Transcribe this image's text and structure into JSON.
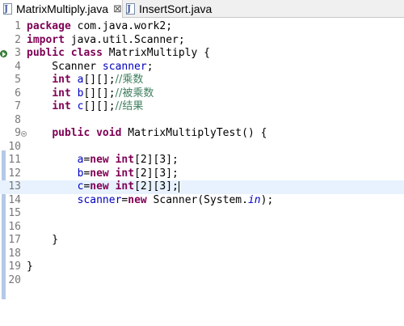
{
  "tabs": [
    {
      "label": "MatrixMultiply.java",
      "close": "⊠"
    },
    {
      "label": "InsertSort.java"
    }
  ],
  "editor": {
    "current_line": 13,
    "lines": [
      {
        "n": "1",
        "tokens": [
          {
            "t": "package",
            "c": "kw"
          },
          {
            "t": " com.java.work2;",
            "c": ""
          }
        ]
      },
      {
        "n": "2",
        "tokens": [
          {
            "t": "import",
            "c": "kw"
          },
          {
            "t": " java.util.Scanner;",
            "c": ""
          }
        ]
      },
      {
        "n": "3",
        "tokens": [
          {
            "t": "public",
            "c": "kw"
          },
          {
            "t": " ",
            "c": ""
          },
          {
            "t": "class",
            "c": "kw"
          },
          {
            "t": " MatrixMultiply {",
            "c": ""
          }
        ]
      },
      {
        "n": "4",
        "tokens": [
          {
            "t": "    Scanner ",
            "c": ""
          },
          {
            "t": "scanner",
            "c": "field"
          },
          {
            "t": ";",
            "c": ""
          }
        ]
      },
      {
        "n": "5",
        "tokens": [
          {
            "t": "    ",
            "c": ""
          },
          {
            "t": "int",
            "c": "kw"
          },
          {
            "t": " ",
            "c": ""
          },
          {
            "t": "a",
            "c": "field"
          },
          {
            "t": "[][];",
            "c": ""
          },
          {
            "t": "//乘数",
            "c": "comment"
          }
        ]
      },
      {
        "n": "6",
        "tokens": [
          {
            "t": "    ",
            "c": ""
          },
          {
            "t": "int",
            "c": "kw"
          },
          {
            "t": " ",
            "c": ""
          },
          {
            "t": "b",
            "c": "field"
          },
          {
            "t": "[][];",
            "c": ""
          },
          {
            "t": "//被乘数",
            "c": "comment"
          }
        ]
      },
      {
        "n": "7",
        "tokens": [
          {
            "t": "    ",
            "c": ""
          },
          {
            "t": "int",
            "c": "kw"
          },
          {
            "t": " ",
            "c": ""
          },
          {
            "t": "c",
            "c": "field"
          },
          {
            "t": "[][];",
            "c": ""
          },
          {
            "t": "//结果",
            "c": "comment"
          }
        ]
      },
      {
        "n": "8",
        "tokens": []
      },
      {
        "n": "9",
        "tokens": [
          {
            "t": "    ",
            "c": ""
          },
          {
            "t": "public",
            "c": "kw"
          },
          {
            "t": " ",
            "c": ""
          },
          {
            "t": "void",
            "c": "kw"
          },
          {
            "t": " MatrixMultiplyTest() {",
            "c": ""
          }
        ]
      },
      {
        "n": "10",
        "tokens": []
      },
      {
        "n": "11",
        "tokens": [
          {
            "t": "        ",
            "c": ""
          },
          {
            "t": "a",
            "c": "field"
          },
          {
            "t": "=",
            "c": ""
          },
          {
            "t": "new",
            "c": "kw"
          },
          {
            "t": " ",
            "c": ""
          },
          {
            "t": "int",
            "c": "kw"
          },
          {
            "t": "[2][3];",
            "c": ""
          }
        ]
      },
      {
        "n": "12",
        "tokens": [
          {
            "t": "        ",
            "c": ""
          },
          {
            "t": "b",
            "c": "field"
          },
          {
            "t": "=",
            "c": ""
          },
          {
            "t": "new",
            "c": "kw"
          },
          {
            "t": " ",
            "c": ""
          },
          {
            "t": "int",
            "c": "kw"
          },
          {
            "t": "[2][3];",
            "c": ""
          }
        ]
      },
      {
        "n": "13",
        "tokens": [
          {
            "t": "        ",
            "c": ""
          },
          {
            "t": "c",
            "c": "field"
          },
          {
            "t": "=",
            "c": ""
          },
          {
            "t": "new",
            "c": "kw"
          },
          {
            "t": " ",
            "c": ""
          },
          {
            "t": "int",
            "c": "kw"
          },
          {
            "t": "[2][3];",
            "c": ""
          }
        ]
      },
      {
        "n": "14",
        "tokens": [
          {
            "t": "        ",
            "c": ""
          },
          {
            "t": "scanner",
            "c": "field"
          },
          {
            "t": "=",
            "c": ""
          },
          {
            "t": "new",
            "c": "kw"
          },
          {
            "t": " Scanner(System.",
            "c": ""
          },
          {
            "t": "in",
            "c": "static-field"
          },
          {
            "t": ");",
            "c": ""
          }
        ]
      },
      {
        "n": "15",
        "tokens": []
      },
      {
        "n": "16",
        "tokens": []
      },
      {
        "n": "17",
        "tokens": [
          {
            "t": "    }",
            "c": ""
          }
        ]
      },
      {
        "n": "18",
        "tokens": []
      },
      {
        "n": "19",
        "tokens": [
          {
            "t": "}",
            "c": ""
          }
        ]
      },
      {
        "n": "20",
        "tokens": []
      }
    ]
  },
  "colors": {
    "keyword": "#7f0055",
    "field": "#0000c0",
    "comment": "#3f7f5f",
    "current_line": "#e8f2fe",
    "range_indicator": "#b4c9e6"
  },
  "icons": {
    "tab_file": "java-file-icon",
    "tab_close": "close-icon",
    "line3_marker": "run-marker-icon",
    "line9_fold": "fold-toggle-icon"
  }
}
